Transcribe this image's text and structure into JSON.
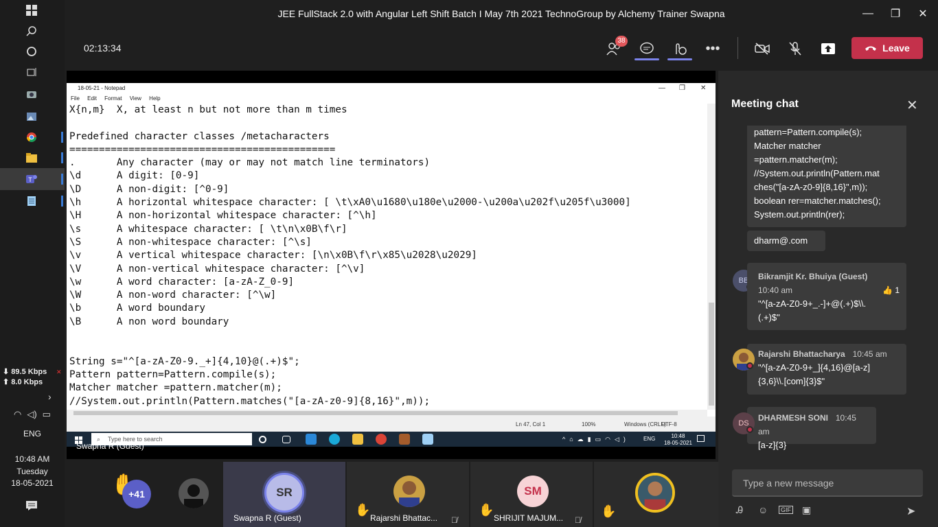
{
  "window": {
    "title": "JEE FullStack 2.0 with Angular Left Shift Batch I May 7th 2021 TechnoGroup by Alchemy Trainer Swapna"
  },
  "toolbar": {
    "timer": "02:13:34",
    "participants_badge": "38",
    "leave_label": "Leave"
  },
  "taskbar": {
    "net_down": "89.5 Kbps",
    "net_up": "8.0 Kbps",
    "lang": "ENG",
    "time": "10:48 AM",
    "day": "Tuesday",
    "date": "18-05-2021"
  },
  "notepad": {
    "title": "18-05-21 - Notepad",
    "menu": [
      "File",
      "Edit",
      "Format",
      "View",
      "Help"
    ],
    "lines": [
      "X{n,m}  X, at least n but not more than m times",
      "",
      "Predefined character classes /metacharacters",
      "=============================================",
      ".       Any character (may or may not match line terminators)",
      "\\d      A digit: [0-9]",
      "\\D      A non-digit: [^0-9]",
      "\\h      A horizontal whitespace character: [ \\t\\xA0\\u1680\\u180e\\u2000-\\u200a\\u202f\\u205f\\u3000]",
      "\\H      A non-horizontal whitespace character: [^\\h]",
      "\\s      A whitespace character: [ \\t\\n\\x0B\\f\\r]",
      "\\S      A non-whitespace character: [^\\s]",
      "\\v      A vertical whitespace character: [\\n\\x0B\\f\\r\\x85\\u2028\\u2029]",
      "\\V      A non-vertical whitespace character: [^\\v]",
      "\\w      A word character: [a-zA-Z_0-9]",
      "\\W      A non-word character: [^\\w]",
      "\\b      A word boundary",
      "\\B      A non word boundary",
      "",
      "",
      "String s=\"^[a-zA-Z0-9._+]{4,10}@(.+)$\";",
      "Pattern pattern=Pattern.compile(s);",
      "Matcher matcher =pattern.matcher(m);",
      "//System.out.println(Pattern.matches(\"[a-zA-z0-9]{8,16}\",m));"
    ],
    "status": {
      "position": "Ln 47, Col 1",
      "zoom": "100%",
      "line_endings": "Windows (CRLF)",
      "encoding": "UTF-8"
    }
  },
  "inner_taskbar": {
    "search_placeholder": "Type here to search",
    "lang": "ENG",
    "time": "10:48",
    "date": "18-05-2021"
  },
  "presenter_name": "Swapna R (Guest)",
  "chat": {
    "title": "Meeting chat",
    "code_lines": [
      "pattern=Pattern.compile(s);",
      "Matcher matcher",
      "=pattern.matcher(m);",
      "//System.out.println(Pattern.mat",
      "ches(\"[a-zA-z0-9]{8,16}\",m));",
      "boolean rer=matcher.matches();",
      "System.out.println(rer);"
    ],
    "plain_msg": "dharm@.com",
    "messages": [
      {
        "initials": "BB",
        "sender": "Bikramjit Kr. Bhuiya (Guest)",
        "time": "10:40 am",
        "reaction_count": "1",
        "lines": [
          "\"^[a-zA-Z0-9+_.-]+@(.+)$\\\\.",
          "(.+)$\""
        ]
      },
      {
        "initials": "",
        "sender": "Rajarshi Bhattacharya",
        "time": "10:45 am",
        "lines": [
          "\"^[a-zA-Z0-9+_]{4,16}@[a-z]",
          "{3,6}\\\\.[com]{3}$\""
        ]
      },
      {
        "initials": "DS",
        "sender": "DHARMESH SONI",
        "time": "10:45 am",
        "lines": [
          "[a-z]{3}"
        ]
      }
    ],
    "compose_placeholder": "Type a new message"
  },
  "participants": {
    "overflow": "+41",
    "tiles": [
      {
        "initials": "SR",
        "name": "Swapna R (Guest)"
      },
      {
        "initials": "",
        "name": "Rajarshi Bhattac..."
      },
      {
        "initials": "SM",
        "name": "SHRIJIT MAJUM..."
      }
    ]
  },
  "colors": {
    "accent": "#7b83eb",
    "leave": "#c4314b",
    "badge": "#e2575b",
    "chat_bg": "#292929",
    "bubble": "#3b3b3b"
  }
}
